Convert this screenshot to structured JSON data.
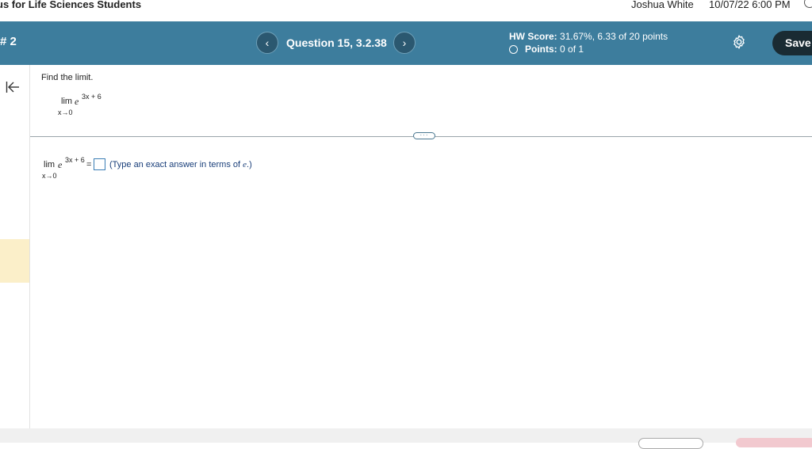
{
  "topbar": {
    "course_title": "us for Life Sciences Students",
    "user_name": "Joshua White",
    "due_date": "10/07/22 6:00 PM"
  },
  "navbar": {
    "hw_number": "# 2",
    "prev_icon": "chevron-left-icon",
    "next_icon": "chevron-right-icon",
    "prev_glyph": "‹",
    "next_glyph": "›",
    "question_label": "Question 15, 3.2.38",
    "hw_score_label": "HW Score:",
    "hw_score_value": "31.67%, 6.33 of 20 points",
    "points_label": "Points:",
    "points_value": "0 of 1",
    "save_label": "Save",
    "bar_color": "#3d7d9d"
  },
  "question": {
    "instruction": "Find the limit.",
    "lim_word": "lim",
    "lim_sub": "x→0",
    "base": "e",
    "exponent": "3x + 6",
    "equals": "=",
    "hint_prefix": "(Type an exact answer in terms of ",
    "hint_var": "e",
    "hint_suffix": ".)",
    "more_label": "···"
  }
}
